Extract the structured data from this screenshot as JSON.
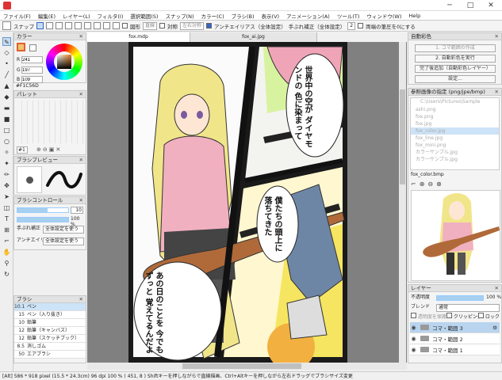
{
  "window": {
    "minimize": "─",
    "maximize": "□",
    "close": "✕"
  },
  "menu": [
    "ファイル(F)",
    "編集(E)",
    "レイヤー(L)",
    "フィルタ(I)",
    "選択範囲(S)",
    "スナップ(N)",
    "カラー(C)",
    "ブラシ(B)",
    "表示(V)",
    "アニメーション(A)",
    "ツール(T)",
    "ウィンドウ(W)",
    "Help"
  ],
  "toolbar": {
    "snap_label": "スナップ",
    "shape_label": "図形",
    "shape_select": "直線",
    "symmetry_label": "対称",
    "symmetry_select": "左右対称",
    "antialias_label": "アンチエイリアス（全体設定）",
    "stabilizer_label": "手ぶれ補正（全体設定）",
    "stabilizer_value": "2",
    "pressure_label": "両端の筆圧を0にする"
  },
  "tabs": [
    "fox.mdp",
    "fox_ai.jpg"
  ],
  "color_panel": {
    "title": "カラー",
    "r_label": "R",
    "r_value": "241",
    "g_label": "G",
    "g_value": "197",
    "b_label": "B",
    "b_value": "109",
    "hex": "#F1C56D",
    "fg_color": "#f1c56d"
  },
  "palette_panel": {
    "title": "パレット",
    "number": "#1"
  },
  "brush_preview": {
    "title": "ブラシプレビュー"
  },
  "brush_control": {
    "title": "ブラシコントロール",
    "size_value": "10",
    "opacity_value": "100 %",
    "stabilizer_label": "手ぶれ補正",
    "stabilizer_value": "全体設定を使う",
    "antialias_label": "アンチエイリアス",
    "antialias_value": "全体設定を使う"
  },
  "brush_panel": {
    "title": "ブラシ",
    "items": [
      {
        "size": "10.1",
        "name": "ペン"
      },
      {
        "size": "15",
        "name": "ペン（入り抜き）"
      },
      {
        "size": "10",
        "name": "鉛筆"
      },
      {
        "size": "12",
        "name": "鉛筆（キャンバス）"
      },
      {
        "size": "12",
        "name": "鉛筆（スケッチブック）"
      },
      {
        "size": "8.5",
        "name": "消しゴム"
      },
      {
        "size": "50",
        "name": "エアブラシ"
      }
    ]
  },
  "auto_coloring": {
    "title": "自動彩色",
    "btn1": "1. コマ範囲の作成",
    "btn2": "2. 自動彩色を実行",
    "btn3": "完了後追加（自動彩色レイヤー）",
    "btn4": "設定..."
  },
  "reference": {
    "title": "参照画像の指定 (png/jpe/bmp)",
    "path": "C:\\Users\\Pictures\\Sample",
    "files": [
      "ashi.png",
      "fox.png",
      "fox.jpg",
      "fox_color.jpg",
      "fox_line.jpg",
      "fox_mini.png",
      "カラーサンプル.jpg",
      "カラーサンプル.jpg"
    ],
    "selected_file": "fox_color.bmp"
  },
  "layers": {
    "title": "レイヤー",
    "opacity_label": "不透明度",
    "opacity_value": "100 %",
    "blend_label": "ブレンド",
    "blend_value": "通常",
    "protect_label": "透明度を保護",
    "clipping_label": "クリッピング",
    "lock_label": "ロック",
    "items": [
      {
        "name": "コマ・範囲 3",
        "selected": true
      },
      {
        "name": "コマ・範囲 2",
        "selected": false
      },
      {
        "name": "コマ・範囲 1",
        "selected": false
      }
    ]
  },
  "manga": {
    "bubble1": "世界中の空が ダイヤモンドの 色に染まって",
    "bubble2": "僕たちの頭上に 落ちてきた",
    "bubble3": "あの日のことを 今でもずっと 覚えてるんだよ"
  },
  "status": "[Alt]   586 * 918 pixel  (15.5 * 24.3cm)  96 dpi  100 %  ( 451, 8 )  Shiftキーを押しながらで直線描画、Ctrl+Altキーを押しながら左右ドラッグでブラシサイズ変更"
}
